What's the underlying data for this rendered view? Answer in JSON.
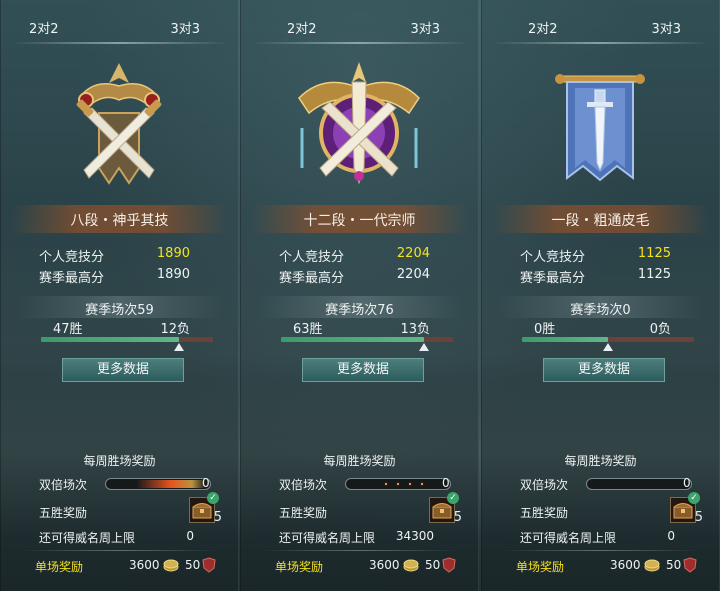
{
  "tabs": {
    "two_v_two": "2对2",
    "three_v_three": "3对3"
  },
  "labels": {
    "personal_score": "个人竞技分",
    "season_high": "赛季最高分",
    "more_data": "更多数据",
    "weekly_rewards": "每周胜场奖励",
    "double_matches": "双倍场次",
    "five_win_reward": "五胜奖励",
    "prestige_left": "还可得威名周上限",
    "per_match_reward": "单场奖励"
  },
  "panels": [
    {
      "rank": "八段・神乎其技",
      "personal_score": "1890",
      "season_high": "1890",
      "season_matches": "赛季场次59",
      "wins": "47胜",
      "losses": "12负",
      "win_ratio": 0.8,
      "double_count": "0",
      "five_win_count": "5",
      "prestige_left": "0",
      "gold": "3600",
      "badges": "50",
      "emblem": "crossed-swords-crest-icon"
    },
    {
      "rank": "十二段・一代宗师",
      "personal_score": "2204",
      "season_high": "2204",
      "season_matches": "赛季场次76",
      "wins": "63胜",
      "losses": "13负",
      "win_ratio": 0.83,
      "double_count": "0",
      "five_win_count": "5",
      "prestige_left": "34300",
      "gold": "3600",
      "badges": "50",
      "emblem": "grandmaster-crest-icon"
    },
    {
      "rank": "一段・粗通皮毛",
      "personal_score": "1125",
      "season_high": "1125",
      "season_matches": "赛季场次0",
      "wins": "0胜",
      "losses": "0负",
      "win_ratio": 0.5,
      "double_count": "0",
      "five_win_count": "5",
      "prestige_left": "0",
      "gold": "3600",
      "badges": "50",
      "emblem": "banner-sword-icon"
    }
  ],
  "colors": {
    "score_highlight": "#f4e21c",
    "win_bar": "#4aa874",
    "loss_bar": "#6a4237",
    "button": "#3c6d6d"
  }
}
